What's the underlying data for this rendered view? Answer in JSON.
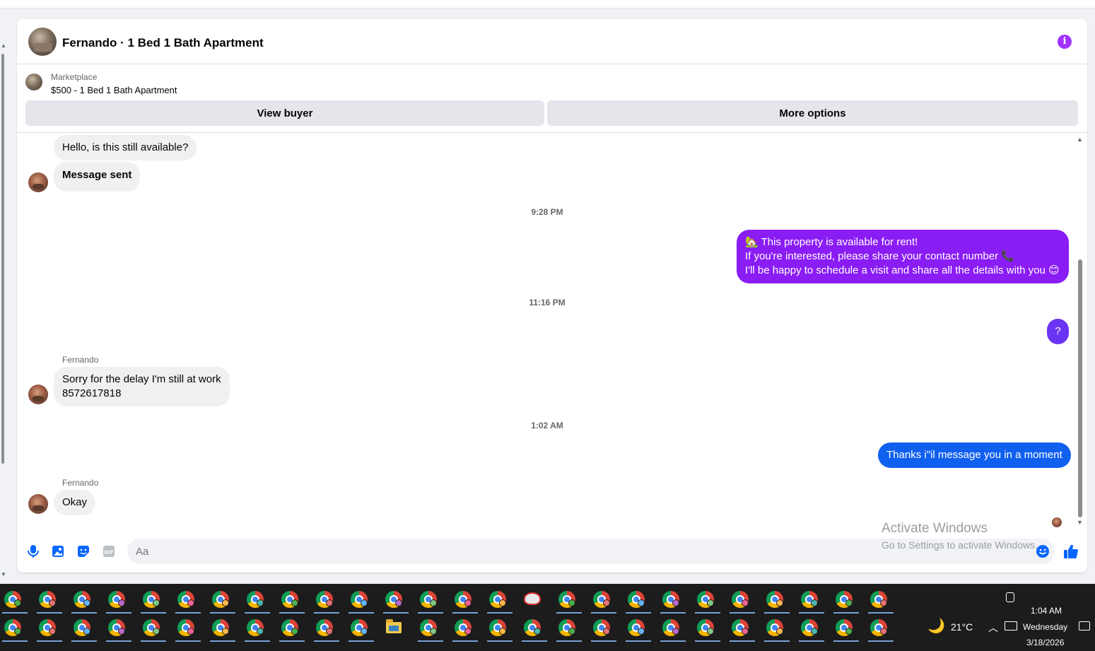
{
  "header": {
    "title": "Fernando · 1 Bed 1 Bath Apartment",
    "info_icon": "i"
  },
  "listing": {
    "source": "Marketplace",
    "price_title": "$500 - 1 Bed 1 Bath Apartment",
    "view_buyer_label": "View buyer",
    "more_options_label": "More options"
  },
  "messages": {
    "m1": "Hello, is this still available?",
    "m2": "Message sent",
    "ts1": "9:28 PM",
    "out1_line1": "🏡 This property is available for rent!",
    "out1_line2": "If you're interested, please share your contact number 📞",
    "out1_line3": "I'll be happy to schedule a visit and share all the details with you 😊",
    "ts2": "11:16 PM",
    "out2": "?",
    "sender1": "Fernando",
    "in3_line1": "Sorry for the delay I'm still at work",
    "in3_line2": "8572617818",
    "ts3": "1:02 AM",
    "out3": "Thanks i\"il message you in a moment",
    "sender2": "Fernando",
    "in4": "Okay"
  },
  "composer": {
    "placeholder": "Aa"
  },
  "watermark": {
    "line1": "Activate Windows",
    "line2": "Go to Settings to activate Windows."
  },
  "tray": {
    "temperature": "21°C",
    "time": "1:04 AM",
    "day": "Wednesday",
    "date": "3/18/2026"
  },
  "colors": {
    "accent_purple": "#8a1cf4",
    "accent_violet": "#6b34f2",
    "accent_blue": "#1060f0",
    "messenger_blue": "#0866ff"
  }
}
